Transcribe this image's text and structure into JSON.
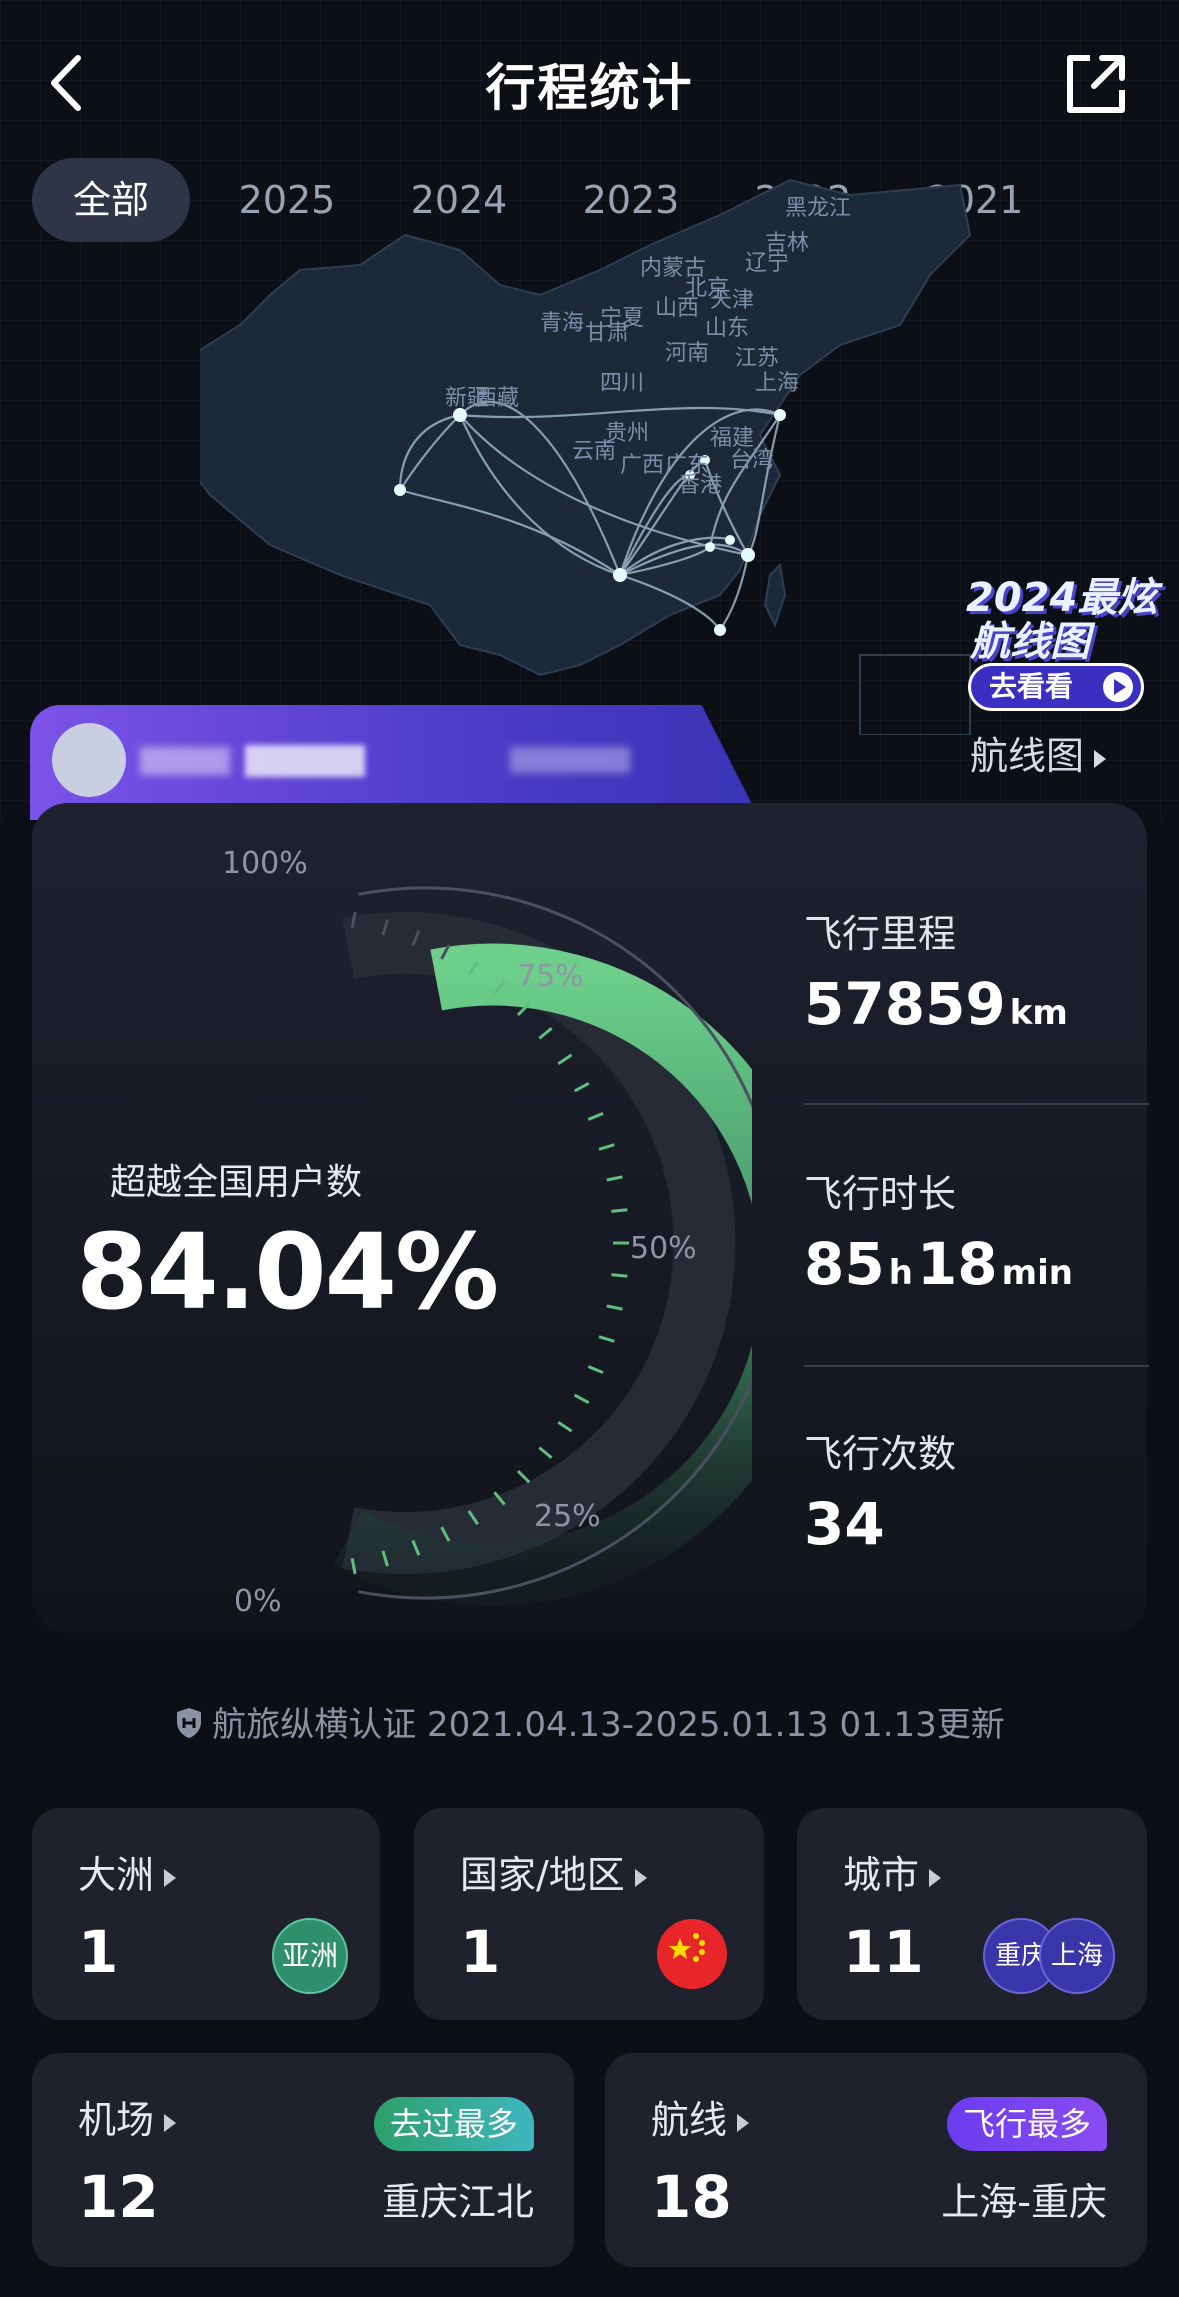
{
  "header": {
    "title": "行程统计"
  },
  "tabs": [
    "全部",
    "2025",
    "2024",
    "2023",
    "2022",
    "2021"
  ],
  "map": {
    "provinces": [
      "黑龙江",
      "吉林",
      "内蒙古",
      "辽宁",
      "新疆",
      "宁夏",
      "山西",
      "北京",
      "天津",
      "青海",
      "甘肃",
      "山东",
      "河南",
      "江苏",
      "西藏",
      "四川",
      "上海",
      "贵州",
      "福建",
      "云南",
      "广西",
      "广东",
      "台湾",
      "香港"
    ]
  },
  "promo": {
    "line1": "2024最炫",
    "line2": "航线图",
    "cta": "去看看"
  },
  "routemap_link": "航线图",
  "gauge": {
    "percent": 84.04,
    "ticks": [
      "100%",
      "75%",
      "50%",
      "25%",
      "0%"
    ],
    "label": "超越全国用户数",
    "value_text": "84.04%"
  },
  "metrics": {
    "distance": {
      "label": "飞行里程",
      "value": "57859",
      "unit": "km"
    },
    "duration": {
      "label": "飞行时长",
      "hours": "85",
      "h_unit": "h",
      "minutes": "18",
      "m_unit": "min"
    },
    "flights": {
      "label": "飞行次数",
      "value": "34"
    }
  },
  "certification": "航旅纵横认证 2021.04.13-2025.01.13 01.13更新",
  "tiles": {
    "continent": {
      "label": "大洲",
      "value": "1",
      "badge": "亚洲"
    },
    "country": {
      "label": "国家/地区",
      "value": "1"
    },
    "city": {
      "label": "城市",
      "value": "11",
      "badges": [
        "重庆",
        "上海"
      ]
    },
    "airport": {
      "label": "机场",
      "value": "12",
      "tag": "去过最多",
      "place": "重庆江北"
    },
    "route": {
      "label": "航线",
      "value": "18",
      "tag": "飞行最多",
      "place": "上海-重庆"
    }
  },
  "colors": {
    "accent_green": "#5fbf7c",
    "accent_purple": "#6b3cf0",
    "tag_green": "#2fa87d",
    "badge_blue": "#3a35a8",
    "flag_red": "#e8262a"
  }
}
